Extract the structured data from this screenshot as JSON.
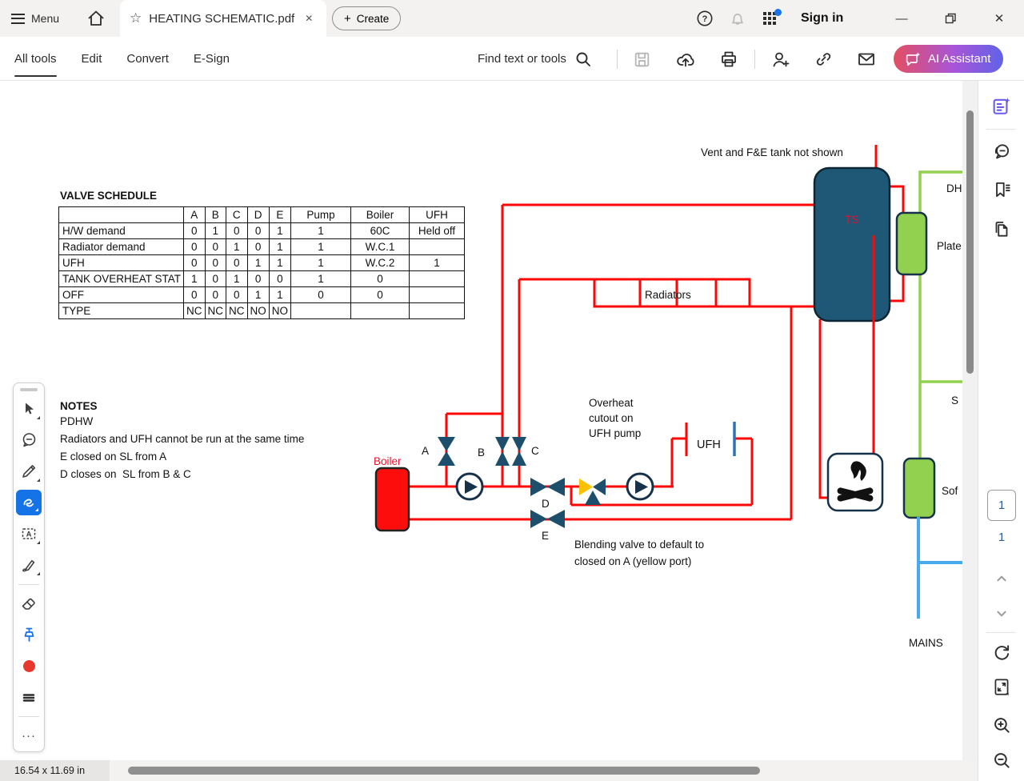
{
  "titlebar": {
    "menu_label": "Menu",
    "tab_title": "HEATING SCHEMATIC.pdf",
    "create_label": "Create",
    "sign_in_label": "Sign in"
  },
  "glyphs": {
    "star": "☆",
    "tab_close": "✕",
    "create_plus": "+",
    "minimize": "—",
    "window_close": "✕",
    "help": "?",
    "ellipsis": "···"
  },
  "toolbar": {
    "nav": [
      "All tools",
      "Edit",
      "Convert",
      "E-Sign"
    ],
    "search_label": "Find text or tools",
    "ai_assistant_label": "AI Assistant"
  },
  "document": {
    "valve_schedule": {
      "title": "VALVE SCHEDULE",
      "headers": [
        "",
        "A",
        "B",
        "C",
        "D",
        "E",
        "Pump",
        "Boiler",
        "UFH"
      ],
      "rows": [
        [
          "H/W demand",
          "0",
          "1",
          "0",
          "0",
          "1",
          "1",
          "60C",
          "Held off"
        ],
        [
          "Radiator demand",
          "0",
          "0",
          "1",
          "0",
          "1",
          "1",
          "W.C.1",
          ""
        ],
        [
          "UFH",
          "0",
          "0",
          "0",
          "1",
          "1",
          "1",
          "W.C.2",
          "1"
        ],
        [
          "TANK OVERHEAT STAT",
          "1",
          "0",
          "1",
          "0",
          "0",
          "1",
          "0",
          ""
        ],
        [
          "OFF",
          "0",
          "0",
          "0",
          "1",
          "1",
          "0",
          "0",
          ""
        ],
        [
          "TYPE",
          "NC",
          "NC",
          "NC",
          "NO",
          "NO",
          "",
          "",
          ""
        ]
      ]
    },
    "notes": {
      "title": "NOTES",
      "lines": [
        "PDHW",
        "Radiators and UFH cannot be run at the same time",
        "E closed on SL from A",
        "D closes on  SL from B & C"
      ]
    },
    "schematic": {
      "vent_note": "Vent and F&E tank not shown",
      "overheat_note_lines": [
        "Overheat",
        "cutout on",
        "UFH pump"
      ],
      "blending_note_lines": [
        "Blending valve to default to",
        "closed on A (yellow port)"
      ],
      "labels": {
        "boiler": "Boiler",
        "ts": "TS",
        "radiators": "Radiators",
        "ufh": "UFH",
        "valve_a": "A",
        "valve_b": "B",
        "valve_c": "C",
        "valve_d": "D",
        "valve_e": "E",
        "mains": "MAINS",
        "dh_clipped": "DH",
        "plate_clipped": "Plate",
        "s_clipped": "S",
        "softener_clipped": "Sof"
      },
      "colors": {
        "hot_pipe": "#ff0505",
        "cold_pipe": "#45abee",
        "green_pipe": "#92d050",
        "tank_fill": "#1f5876",
        "valve_fill": "#1d4e6b",
        "blend_port_yellow": "#ffc000",
        "boiler_fill": "#fe0d0d"
      }
    }
  },
  "right_panel": {
    "current_page": "1",
    "total_pages": "1"
  },
  "statusbar": {
    "page_dimensions": "16.54 x 11.69 in"
  }
}
